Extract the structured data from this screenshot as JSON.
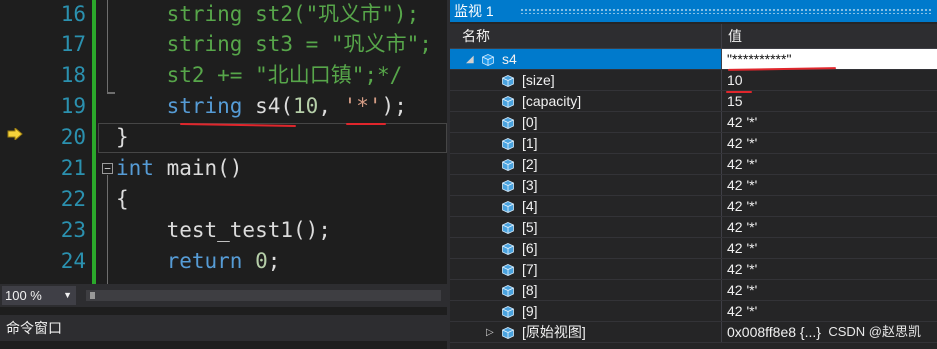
{
  "editor": {
    "lines": [
      {
        "num": "16",
        "text": "    string st2(\"巩义市\");"
      },
      {
        "num": "17",
        "text": "    string st3 = \"巩义市\";"
      },
      {
        "num": "18",
        "text": "    st2 += \"北山口镇\";*/"
      },
      {
        "num": "19",
        "text": "    string s4(10, '*');"
      },
      {
        "num": "20",
        "text": "}"
      },
      {
        "num": "21",
        "text": "int main()"
      },
      {
        "num": "22",
        "text": "{"
      },
      {
        "num": "23",
        "text": "    test_test1();"
      },
      {
        "num": "24",
        "text": "    return 0;"
      }
    ],
    "zoom": "100 %"
  },
  "command_window": {
    "title": "命令窗口"
  },
  "watch": {
    "title": "监视 1",
    "columns": {
      "name": "名称",
      "value": "值"
    },
    "rows": [
      {
        "name": "s4",
        "value": "\"**********\""
      },
      {
        "name": "[size]",
        "value": "10"
      },
      {
        "name": "[capacity]",
        "value": "15"
      },
      {
        "name": "[0]",
        "value": "42 '*'"
      },
      {
        "name": "[1]",
        "value": "42 '*'"
      },
      {
        "name": "[2]",
        "value": "42 '*'"
      },
      {
        "name": "[3]",
        "value": "42 '*'"
      },
      {
        "name": "[4]",
        "value": "42 '*'"
      },
      {
        "name": "[5]",
        "value": "42 '*'"
      },
      {
        "name": "[6]",
        "value": "42 '*'"
      },
      {
        "name": "[7]",
        "value": "42 '*'"
      },
      {
        "name": "[8]",
        "value": "42 '*'"
      },
      {
        "name": "[9]",
        "value": "42 '*'"
      },
      {
        "name": "[原始视图]",
        "value": "0x008ff8e8 {...}"
      }
    ]
  },
  "watermark": "CSDN @赵思凯",
  "colors": {
    "accent": "#007acc",
    "annotation": "#e0262c",
    "green_bar": "#2ba82b"
  }
}
